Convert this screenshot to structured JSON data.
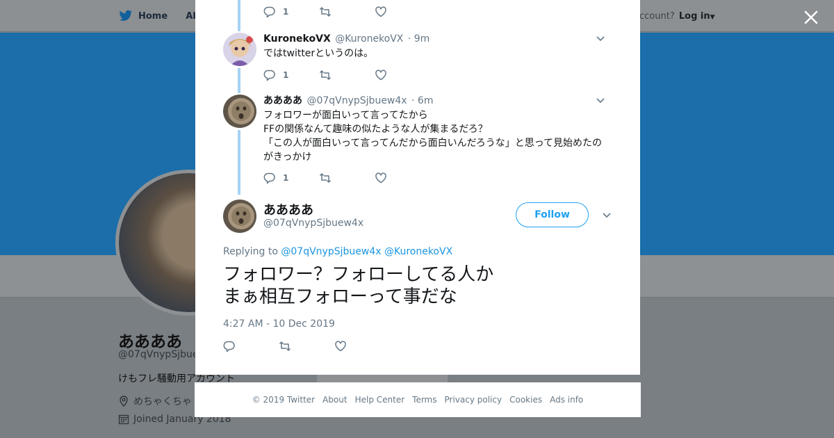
{
  "background": {
    "nav": {
      "home": "Home",
      "about": "Abo"
    },
    "account": {
      "prompt": "ccount?",
      "login": "Log in"
    },
    "profile": {
      "name": "ああああ",
      "handle": "@07qVnypSjbuew",
      "bio": "けもフレ騒動用アカウント",
      "location": "めちゃくちゃ",
      "joined": "Joined January 2018"
    }
  },
  "modal": {
    "top_actions": {
      "reply_count": "1"
    },
    "replies": [
      {
        "name": "KuronekoVX",
        "handle": "@KuronekoVX",
        "time": "· 9m",
        "lines": [
          "ではtwitterというのは。"
        ],
        "reply_count": "1"
      },
      {
        "name": "ああああ",
        "handle": "@07qVnypSjbuew4x",
        "time": "· 6m",
        "lines": [
          "フォロワーが面白いって言ってたから",
          "FFの関係なんて趣味の似たような人が集まるだろ？",
          "「この人が面白いって言ってんだから面白いんだろうな」と思って見始めたの",
          "がきっかけ"
        ],
        "reply_count": "1"
      }
    ],
    "main_tweet": {
      "name": "ああああ",
      "handle": "@07qVnypSjbuew4x",
      "follow_label": "Follow",
      "replying_prefix": "Replying to",
      "mentions": [
        "@07qVnypSjbuew4x",
        "@KuronekoVX"
      ],
      "text_lines": [
        "フォロワー？フォローしてる人か",
        "まぁ相互フォローって事だな"
      ],
      "timestamp": "4:27 AM - 10 Dec 2019"
    }
  },
  "footer": {
    "copyright": "© 2019 Twitter",
    "links": [
      "About",
      "Help Center",
      "Terms",
      "Privacy policy",
      "Cookies",
      "Ads info"
    ]
  },
  "colors": {
    "accent": "#1da1f2",
    "thread_line": "#a6d2f3",
    "muted_text": "#657786",
    "banner": "#1b6ea9"
  },
  "icons": [
    "twitter-bird-icon",
    "close-icon",
    "reply-icon",
    "retweet-icon",
    "like-icon",
    "chevron-down-icon",
    "location-icon",
    "calendar-icon"
  ]
}
